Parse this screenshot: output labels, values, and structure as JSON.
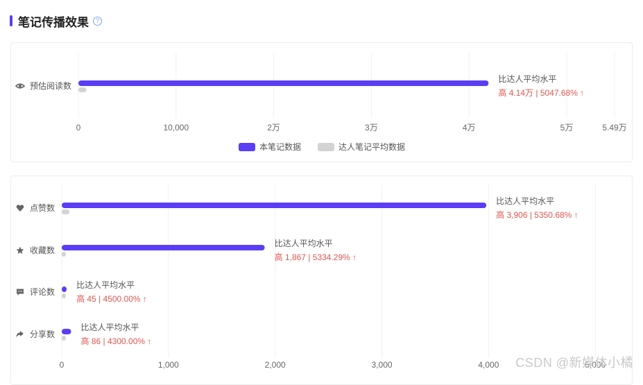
{
  "header": {
    "title": "笔记传播效果",
    "help_icon": "?"
  },
  "chart_data": [
    {
      "type": "bar",
      "orientation": "horizontal",
      "categories": [
        "预估阅读数"
      ],
      "category_icons": [
        "eye-icon"
      ],
      "series": [
        {
          "name": "本笔记数据",
          "color": "#5b3df5",
          "values": [
            42000
          ]
        },
        {
          "name": "达人笔记平均数据",
          "color": "#d3d3d3",
          "values": [
            820
          ]
        }
      ],
      "annotations": [
        {
          "label": "比达人平均水平",
          "detail": "高 4.14万 | 5047.68%",
          "arrow": "↑"
        }
      ],
      "x_ticks": [
        {
          "value": 0,
          "label": "0"
        },
        {
          "value": 10000,
          "label": "10,000"
        },
        {
          "value": 20000,
          "label": "2万"
        },
        {
          "value": 30000,
          "label": "3万"
        },
        {
          "value": 40000,
          "label": "4万"
        },
        {
          "value": 50000,
          "label": "5万"
        },
        {
          "value": 54900,
          "label": "5.49万"
        }
      ],
      "xlim": [
        0,
        54900
      ],
      "legend_position": "bottom-center",
      "grid": true
    },
    {
      "type": "bar",
      "orientation": "horizontal",
      "categories": [
        "点赞数",
        "收藏数",
        "评论数",
        "分享数"
      ],
      "category_icons": [
        "heart-icon",
        "star-icon",
        "comment-icon",
        "share-icon"
      ],
      "series": [
        {
          "name": "本笔记数据",
          "color": "#5b3df5",
          "values": [
            3979,
            1902,
            46,
            88
          ]
        },
        {
          "name": "达人笔记平均数据",
          "color": "#d3d3d3",
          "values": [
            73,
            35,
            1,
            2
          ]
        }
      ],
      "annotations": [
        {
          "label": "比达人平均水平",
          "detail": "高 3,906 | 5350.68%",
          "arrow": "↑"
        },
        {
          "label": "比达人平均水平",
          "detail": "高 1,867 | 5334.29%",
          "arrow": "↑"
        },
        {
          "label": "比达人平均水平",
          "detail": "高 45 | 4500.00%",
          "arrow": "↑"
        },
        {
          "label": "比达人平均水平",
          "detail": "高 86 | 4300.00%",
          "arrow": "↑"
        }
      ],
      "x_ticks": [
        {
          "value": 0,
          "label": "0"
        },
        {
          "value": 1000,
          "label": "1,000"
        },
        {
          "value": 2000,
          "label": "2,000"
        },
        {
          "value": 3000,
          "label": "3,000"
        },
        {
          "value": 4000,
          "label": "4,000"
        },
        {
          "value": 5000,
          "label": "5,000"
        }
      ],
      "xlim": [
        0,
        5200
      ],
      "grid": true
    }
  ],
  "watermark": "CSDN @新媒体小橘"
}
